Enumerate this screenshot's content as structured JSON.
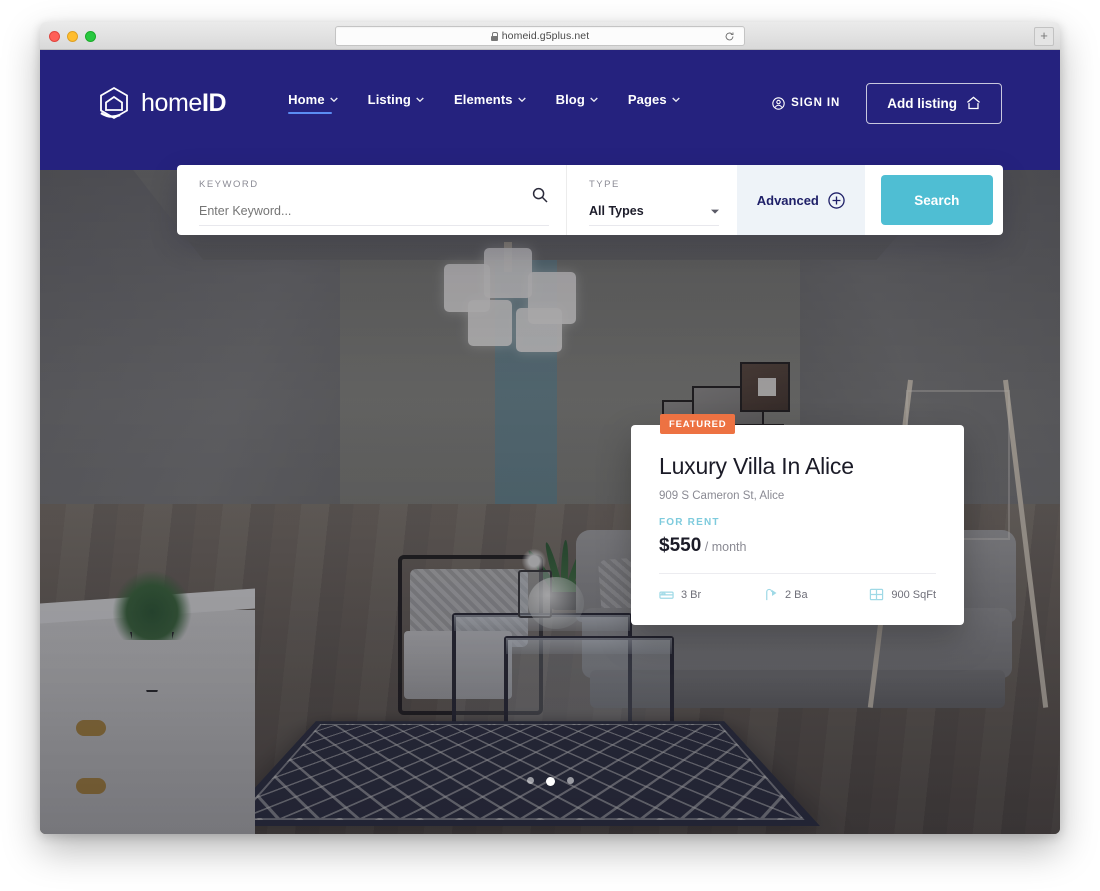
{
  "browser": {
    "url": "homeid.g5plus.net",
    "lock_icon": "lock-icon",
    "reload_icon": "reload-icon",
    "newtab_label": "+"
  },
  "header": {
    "logo": {
      "text_light": "home",
      "text_bold": "ID",
      "icon": "home-logo-icon"
    },
    "menu": [
      {
        "label": "Home",
        "active": true
      },
      {
        "label": "Listing",
        "active": false
      },
      {
        "label": "Elements",
        "active": false
      },
      {
        "label": "Blog",
        "active": false
      },
      {
        "label": "Pages",
        "active": false
      }
    ],
    "signin_label": "SIGN IN",
    "add_listing_label": "Add listing"
  },
  "search": {
    "keyword_label": "KEYWORD",
    "keyword_placeholder": "Enter Keyword...",
    "type_label": "TYPE",
    "type_value": "All Types",
    "advanced_label": "Advanced",
    "search_button": "Search"
  },
  "property_card": {
    "badge": "FEATURED",
    "title": "Luxury Villa In Alice",
    "address": "909 S Cameron St, Alice",
    "status": "FOR RENT",
    "price": "$550",
    "price_period": "/ month",
    "meta": [
      {
        "icon": "bed-icon",
        "value": "3 Br"
      },
      {
        "icon": "shower-icon",
        "value": "2 Ba"
      },
      {
        "icon": "area-icon",
        "value": "900 SqFt"
      }
    ]
  },
  "carousel": {
    "slides": 3,
    "active_index": 1
  },
  "colors": {
    "nav_bg": "#25227e",
    "accent_teal": "#4fbed3",
    "badge_orange": "#ed7242",
    "advanced_bg": "#eef3f8",
    "active_underline": "#5b8df3"
  }
}
